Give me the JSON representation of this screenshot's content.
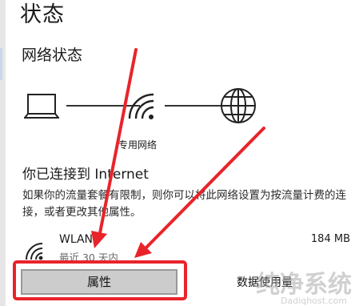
{
  "page": {
    "title": "状态",
    "section_title": "网络状态"
  },
  "network": {
    "label": "专用网络",
    "connected_text": "你已连接到 Internet",
    "description": "如果你的流量套餐有限制，则你可以将此网络设置为按流量计费的连接，或者更改其他属性。"
  },
  "connection": {
    "name": "WLAN",
    "subtitle": "最近 30 天内",
    "usage": "184 MB"
  },
  "buttons": {
    "properties": "属性",
    "data_usage": "数据使用量"
  },
  "watermark": {
    "text": "纯净系统",
    "sub": "Dadiqhost.com"
  },
  "colors": {
    "highlight": "#e8242a",
    "button_bg": "#cccccc"
  },
  "icons": {
    "device": "laptop-icon",
    "wifi": "wifi-icon",
    "internet": "globe-icon",
    "wlan": "wifi-signal-icon"
  }
}
